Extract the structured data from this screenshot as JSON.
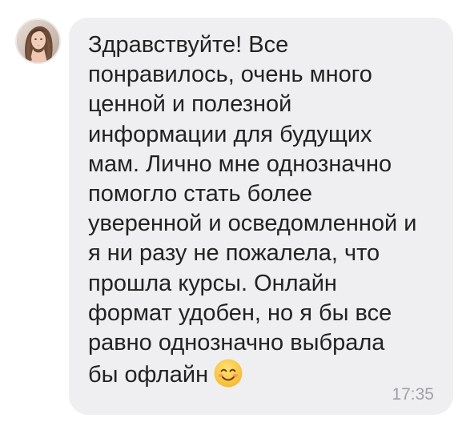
{
  "message": {
    "text": "Здравствуйте! Все\nпонравилось, очень много\nценной и полезной\nинформации для будущих\nмам. Лично мне однозначно\nпомогло стать более\nуверенной и осведомленной и\nя ни разу не пожалела, что\nпрошла курсы. Онлайн\nформат удобен, но я бы все\nравно однозначно выбрала\nбы офлайн",
    "emoji": "smiling-face-with-smiling-eyes",
    "time": "17:35"
  },
  "colors": {
    "bubble": "#efeff1",
    "text": "#222222",
    "time": "#a0a0a6",
    "emoji": "#f7c437"
  }
}
